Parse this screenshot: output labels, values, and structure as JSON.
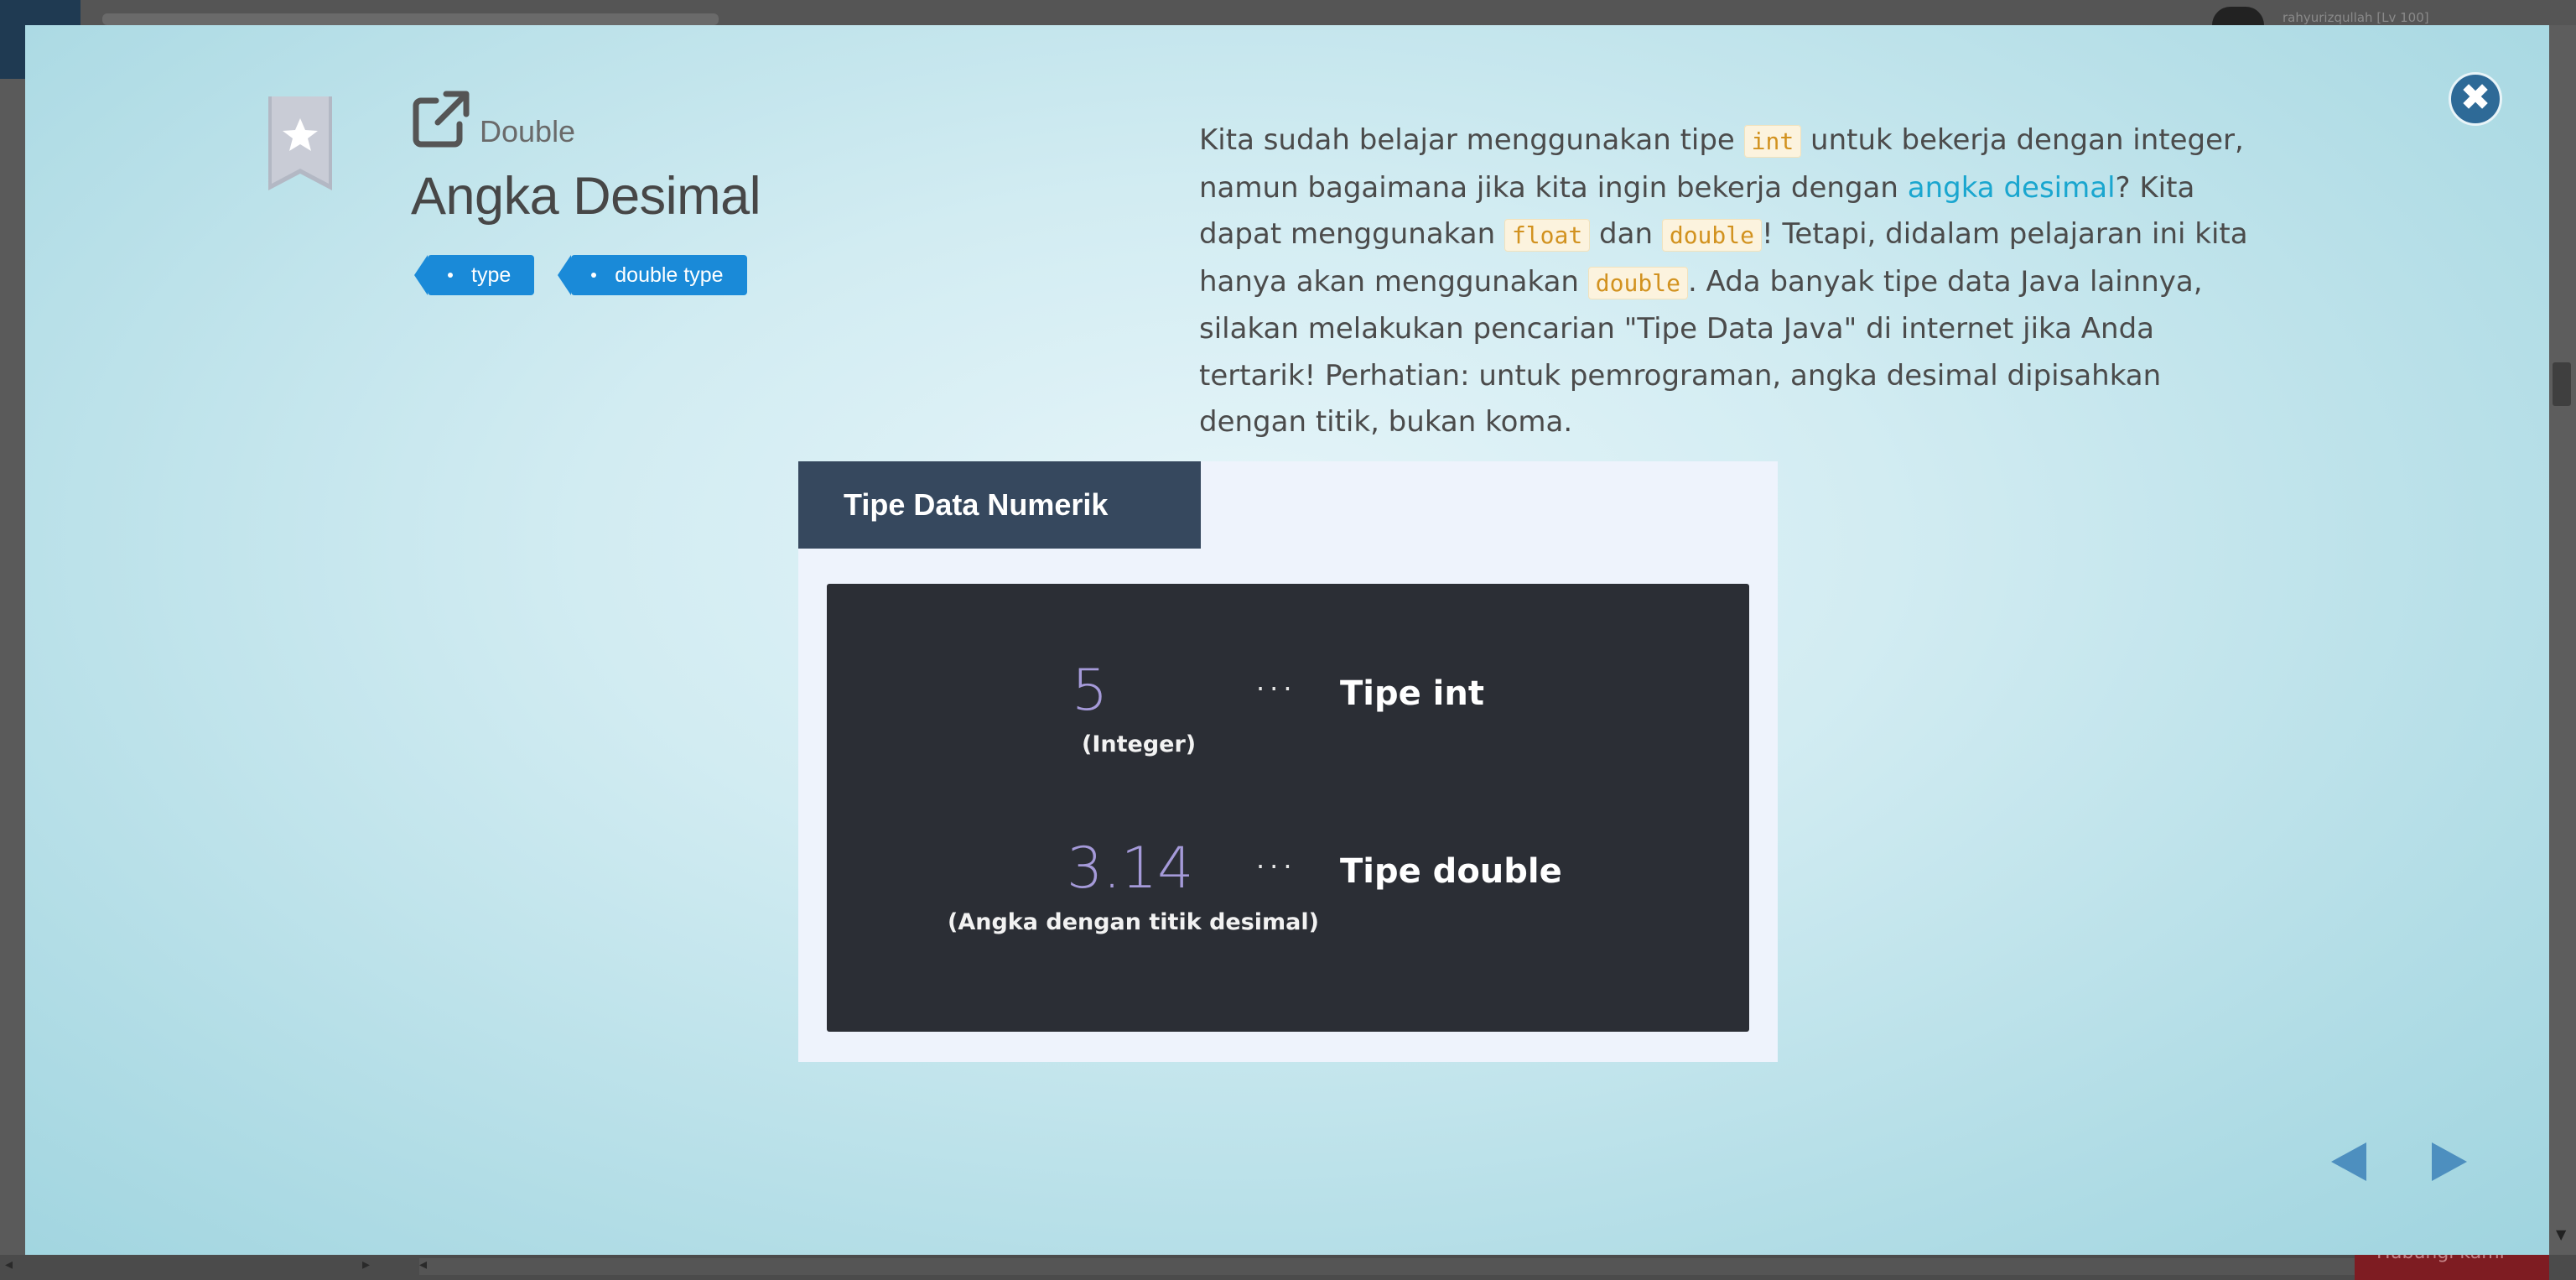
{
  "background": {
    "user_name": "rahyurizqullah [Lv 100]",
    "footer_button_label": "Hubungi kami"
  },
  "modal": {
    "subtitle": "Double",
    "title": "Angka Desimal",
    "tags": [
      "type",
      "double type"
    ],
    "description": {
      "p1": "Kita sudah belajar menggunakan tipe ",
      "code_int": "int",
      "p2": " untuk bekerja dengan integer, namun bagaimana jika kita ingin bekerja dengan ",
      "link": "angka desimal",
      "p3": "? Kita dapat menggunakan ",
      "code_float": "float",
      "p4": " dan ",
      "code_double1": "double",
      "p5": "! Tetapi, didalam pelajaran ini kita hanya akan menggunakan ",
      "code_double2": "double",
      "p6": ". Ada banyak tipe data Java lainnya, silakan melakukan pencarian \"Tipe Data Java\" di internet jika Anda tertarik! Perhatian: untuk pemrograman, angka desimal dipisahkan dengan titik, bukan koma."
    },
    "figure": {
      "header": "Tipe Data Numerik",
      "rows": [
        {
          "number": "5",
          "caption": "(Integer)",
          "dots": "···",
          "type_label": "Tipe int"
        },
        {
          "number": "3.14",
          "caption": "(Angka dengan titik desimal)",
          "dots": "···",
          "type_label": "Tipe double"
        }
      ]
    },
    "close_glyph": "✖",
    "icons": {
      "bookmark": "bookmark-star-icon",
      "title": "external-link-icon",
      "close": "close-icon",
      "prev": "arrow-left-icon",
      "next": "arrow-right-icon"
    },
    "colors": {
      "tag": "#1a8ad8",
      "link": "#1aa6cf",
      "code": "#d2921f",
      "figure_header": "#36485e",
      "figure_panel": "#2b2e35",
      "number": "#a59ad9",
      "close_button": "#2e6a97"
    }
  }
}
